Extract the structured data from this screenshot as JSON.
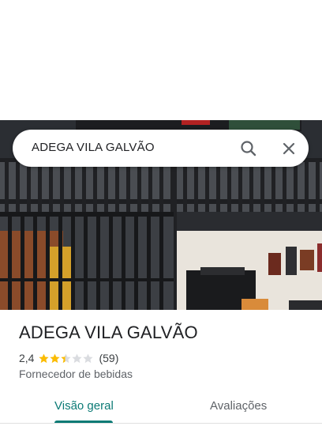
{
  "search": {
    "query": "ADEGA VILA GALVÃO"
  },
  "place": {
    "name": "ADEGA VILA GALVÃO",
    "rating": "2,4",
    "rating_value": 2.4,
    "reviews_count": "(59)",
    "category": "Fornecedor de bebidas"
  },
  "tabs": [
    {
      "label": "Visão geral",
      "active": true
    },
    {
      "label": "Avaliações",
      "active": false
    }
  ],
  "colors": {
    "accent": "#0b7a75",
    "star_filled": "#fbbc04",
    "star_empty": "#dadce0"
  },
  "icons": {
    "search": "search-icon",
    "close": "close-icon",
    "star": "star-icon"
  }
}
